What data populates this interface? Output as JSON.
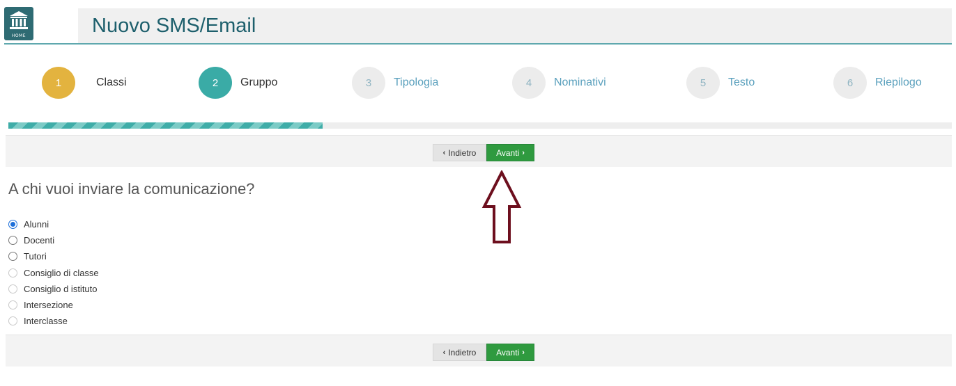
{
  "header": {
    "home_label": "HOME",
    "title": "Nuovo SMS/Email"
  },
  "steps": [
    {
      "number": "1",
      "label": "Classi",
      "state": "done"
    },
    {
      "number": "2",
      "label": "Gruppo",
      "state": "active"
    },
    {
      "number": "3",
      "label": "Tipologia",
      "state": "todo"
    },
    {
      "number": "4",
      "label": "Nominativi",
      "state": "todo"
    },
    {
      "number": "5",
      "label": "Testo",
      "state": "todo"
    },
    {
      "number": "6",
      "label": "Riepilogo",
      "state": "todo"
    }
  ],
  "progress": {
    "completed_fraction": 0.333
  },
  "nav": {
    "back_label": "Indietro",
    "next_label": "Avanti"
  },
  "question": "A chi vuoi inviare la comunicazione?",
  "recipients": [
    {
      "label": "Alunni",
      "checked": true,
      "enabled": true
    },
    {
      "label": "Docenti",
      "checked": false,
      "enabled": true
    },
    {
      "label": "Tutori",
      "checked": false,
      "enabled": true
    },
    {
      "label": "Consiglio di classe",
      "checked": false,
      "enabled": false
    },
    {
      "label": "Consiglio d istituto",
      "checked": false,
      "enabled": false
    },
    {
      "label": "Intersezione",
      "checked": false,
      "enabled": false
    },
    {
      "label": "Interclasse",
      "checked": false,
      "enabled": false
    }
  ],
  "colors": {
    "accent": "#1d5f6c",
    "step_done": "#e3b33f",
    "step_active": "#3aaba6",
    "next_button": "#2f9a3f",
    "annotation_arrow": "#6d0f1e"
  },
  "icons": {
    "home": "bank-building-icon",
    "back": "chevron-left-icon",
    "next": "chevron-right-icon",
    "annotation": "arrow-up-outline-icon"
  }
}
